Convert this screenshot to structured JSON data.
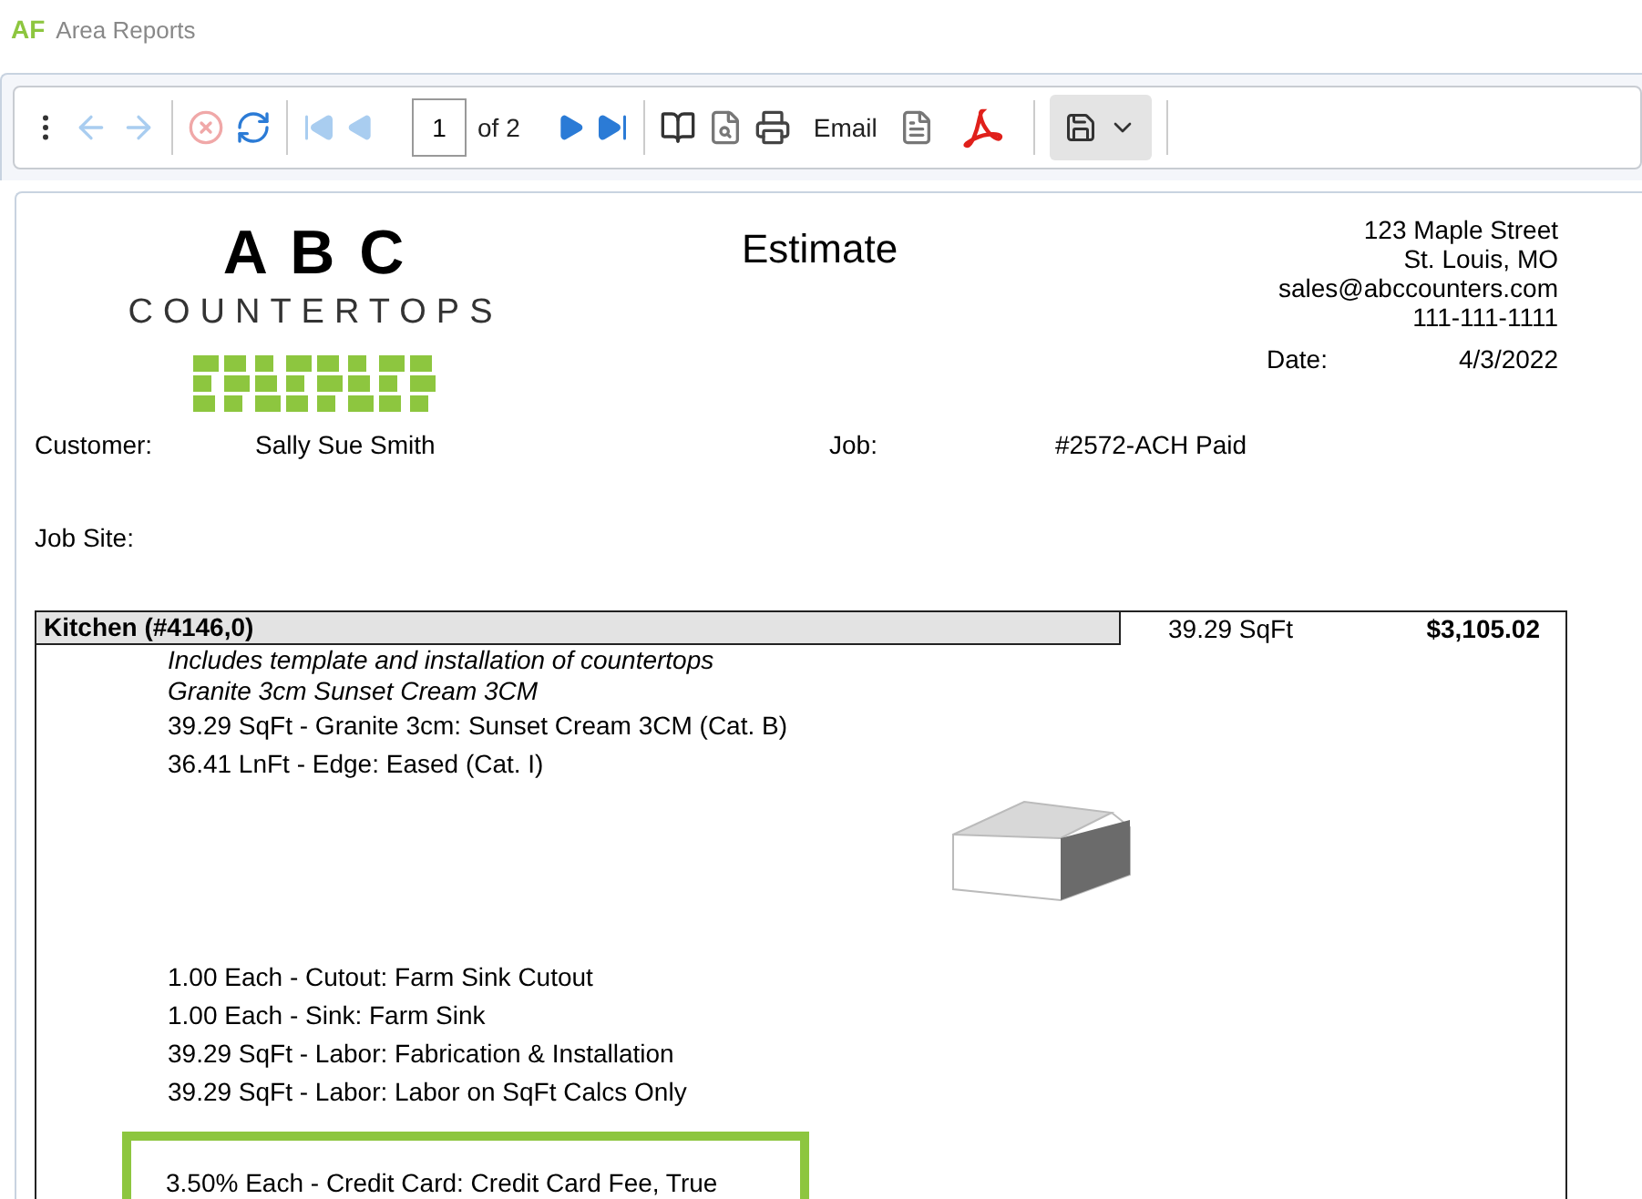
{
  "window": {
    "logo": "AF",
    "title": "Area Reports"
  },
  "toolbar": {
    "page": "1",
    "page_count": "of 2",
    "email": "Email"
  },
  "report": {
    "brand": "A B C",
    "brand_sub": "COUNTERTOPS",
    "title": "Estimate",
    "address": [
      "123 Maple Street",
      "St. Louis, MO",
      "sales@abccounters.com",
      "111-111-1111"
    ],
    "date_label": "Date:",
    "date": "4/3/2022",
    "customer_label": "Customer:",
    "customer": "Sally Sue Smith",
    "job_label": "Job:",
    "job": "#2572-ACH Paid",
    "job_site_label": "Job Site:",
    "area": {
      "name": "Kitchen  (#4146,0)",
      "quantity": "39.29 SqFt",
      "total": "$3,105.02",
      "notes": [
        "Includes template and installation of countertops",
        "Granite 3cm Sunset Cream 3CM"
      ],
      "items": [
        "39.29 SqFt - Granite 3cm: Sunset Cream 3CM (Cat. B)",
        "36.41 LnFt - Edge: Eased (Cat. I)"
      ],
      "more_items": [
        "1.00 Each - Cutout: Farm Sink Cutout",
        "1.00 Each - Sink: Farm Sink",
        "39.29 SqFt - Labor: Fabrication & Installation",
        "39.29 SqFt - Labor: Labor on SqFt Calcs Only"
      ],
      "highlighted_item": "3.50% Each - Credit Card: Credit Card Fee, True"
    }
  }
}
